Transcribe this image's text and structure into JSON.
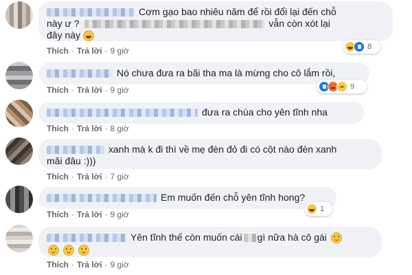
{
  "comments": [
    {
      "text_a": "Cơm gạo bao nhiêu năm để rồi đổi lại đến chỗ",
      "text_b": "này ư ?",
      "text_c": "vẫn còn xót lại",
      "text_d": "đây này",
      "reaction_count": "8",
      "reply_label": "Trả lời",
      "like_label": "Thích",
      "time": "9 giờ"
    },
    {
      "text": "Nó chưa đưa ra bãi tha ma là mừng cho cô lắm rồi,",
      "reaction_count": "9",
      "reply_label": "Trả lời",
      "like_label": "Thích",
      "time": "9 giờ"
    },
    {
      "text": "đưa ra chùa cho yên tĩnh nha",
      "reply_label": "Trả lời",
      "like_label": "Thích",
      "time": "8 giờ"
    },
    {
      "text_a": "xanh mà k đi thì về mẹ đèn đỏ đi có cột nào đèn xanh",
      "text_b": "mãi đâu :)))",
      "reply_label": "Trả lời",
      "like_label": "Thích",
      "time": "7 giờ"
    },
    {
      "text": "Em muốn đến chỗ yên tĩnh hong?",
      "reaction_count": "1",
      "reply_label": "Trả lời",
      "like_label": "Thích",
      "time": "9 giờ"
    },
    {
      "text_a": "Yên tĩnh thế còn muốn cái",
      "text_b": "gì nữa hà cô gái",
      "reply_label": "Trả lời",
      "like_label": "Thích",
      "time": "9 giờ"
    }
  ],
  "icons": {
    "reactions_1": [
      "haha-icon",
      "like-icon"
    ],
    "reactions_2": [
      "like-icon",
      "angry-icon",
      "sad-icon"
    ],
    "reactions_5": [
      "haha-icon"
    ],
    "emoji": "smiley-icon"
  },
  "colors": {
    "bubble": "#f0f2f5",
    "meta_text": "#65676b",
    "like_blue": "#1877f2"
  }
}
